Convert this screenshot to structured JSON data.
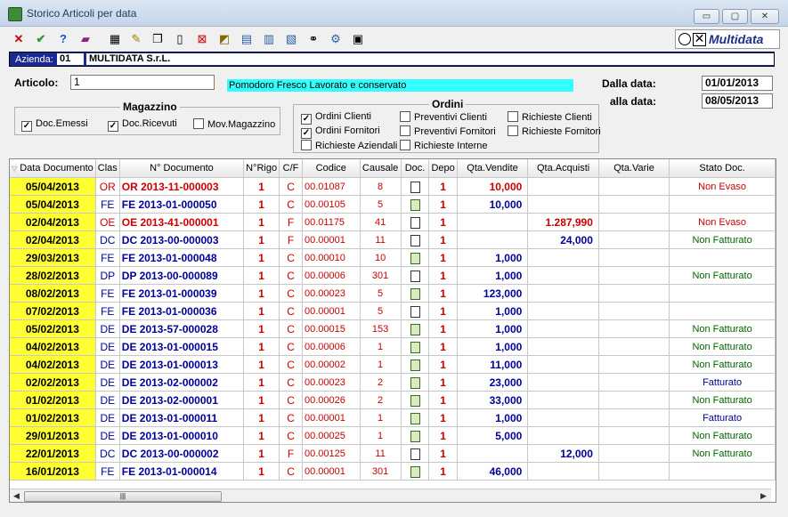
{
  "window": {
    "title": "Storico Articoli per data",
    "min": "▭",
    "max": "▢",
    "close": "✕"
  },
  "toolbar": {
    "icons": [
      "close-x-icon",
      "ok-check-icon",
      "help-icon",
      "book-icon",
      "print-icon",
      "edit-icon",
      "copy-icon",
      "new-doc-icon",
      "delete-icon",
      "chart-icon",
      "window-icon",
      "export-icon",
      "import-icon",
      "binoculars-icon",
      "settings-icon",
      "calc-icon"
    ]
  },
  "logo": {
    "text": "Multidata"
  },
  "azienda": {
    "label": "Azienda:",
    "code": "01",
    "name": "MULTIDATA S.r.L."
  },
  "articolo": {
    "label": "Articolo:",
    "value": "1",
    "description": "Pomodoro Fresco Lavorato e conservato"
  },
  "dates": {
    "from_label": "Dalla data:",
    "from": "01/01/2013",
    "to_label": "alla data:",
    "to": "08/05/2013"
  },
  "magazzino": {
    "title": "Magazzino",
    "options": [
      {
        "label": "Doc.Emessi",
        "checked": true
      },
      {
        "label": "Doc.Ricevuti",
        "checked": true
      },
      {
        "label": "Mov.Magazzino",
        "checked": false
      }
    ]
  },
  "ordini": {
    "title": "Ordini",
    "options": [
      {
        "label": "Ordini Clienti",
        "checked": true
      },
      {
        "label": "Preventivi Clienti",
        "checked": false
      },
      {
        "label": "Richieste Clienti",
        "checked": false
      },
      {
        "label": "Ordini Fornitori",
        "checked": true
      },
      {
        "label": "Preventivi Fornitori",
        "checked": false
      },
      {
        "label": "Richieste Fornitori",
        "checked": false
      },
      {
        "label": "Richieste Aziendali",
        "checked": false
      },
      {
        "label": "Richieste Interne",
        "checked": false
      }
    ]
  },
  "columns": [
    "Data Documento",
    "Clas",
    "N° Documento",
    "N°Rigo",
    "C/F",
    "Codice",
    "Causale",
    "Doc.",
    "Depo",
    "Qta.Vendite",
    "Qta.Acquisti",
    "Qta.Varie",
    "Stato Doc."
  ],
  "colors": {
    "red": "#cc0000",
    "blue": "#000099",
    "green": "#006600",
    "date_bg": "#ffff33"
  },
  "rows": [
    {
      "date": "05/04/2013",
      "clas": "OR",
      "num": "OR 2013-11-000003",
      "rigo": "1",
      "cf": "C",
      "codice": "00.01087",
      "causale": "8",
      "doc": "blank",
      "depo": "1",
      "vend": "10,000",
      "acq": "",
      "varie": "",
      "stato": "Non Evaso",
      "color": "red"
    },
    {
      "date": "05/04/2013",
      "clas": "FE",
      "num": "FE 2013-01-000050",
      "rigo": "1",
      "cf": "C",
      "codice": "00.00105",
      "causale": "5",
      "doc": "filled",
      "depo": "1",
      "vend": "10,000",
      "acq": "",
      "varie": "",
      "stato": "",
      "color": "blue"
    },
    {
      "date": "02/04/2013",
      "clas": "OE",
      "num": "OE 2013-41-000001",
      "rigo": "1",
      "cf": "F",
      "codice": "00.01175",
      "causale": "41",
      "doc": "blank",
      "depo": "1",
      "vend": "",
      "acq": "1.287,990",
      "varie": "",
      "stato": "Non Evaso",
      "color": "red"
    },
    {
      "date": "02/04/2013",
      "clas": "DC",
      "num": "DC 2013-00-000003",
      "rigo": "1",
      "cf": "F",
      "codice": "00.00001",
      "causale": "11",
      "doc": "blank",
      "depo": "1",
      "vend": "",
      "acq": "24,000",
      "varie": "",
      "stato": "Non Fatturato",
      "color": "blue"
    },
    {
      "date": "29/03/2013",
      "clas": "FE",
      "num": "FE 2013-01-000048",
      "rigo": "1",
      "cf": "C",
      "codice": "00.00010",
      "causale": "10",
      "doc": "filled",
      "depo": "1",
      "vend": "1,000",
      "acq": "",
      "varie": "",
      "stato": "",
      "color": "blue"
    },
    {
      "date": "28/02/2013",
      "clas": "DP",
      "num": "DP 2013-00-000089",
      "rigo": "1",
      "cf": "C",
      "codice": "00.00006",
      "causale": "301",
      "doc": "blank",
      "depo": "1",
      "vend": "1,000",
      "acq": "",
      "varie": "",
      "stato": "Non Fatturato",
      "color": "blue"
    },
    {
      "date": "08/02/2013",
      "clas": "FE",
      "num": "FE 2013-01-000039",
      "rigo": "1",
      "cf": "C",
      "codice": "00.00023",
      "causale": "5",
      "doc": "filled",
      "depo": "1",
      "vend": "123,000",
      "acq": "",
      "varie": "",
      "stato": "",
      "color": "blue"
    },
    {
      "date": "07/02/2013",
      "clas": "FE",
      "num": "FE 2013-01-000036",
      "rigo": "1",
      "cf": "C",
      "codice": "00.00001",
      "causale": "5",
      "doc": "blank",
      "depo": "1",
      "vend": "1,000",
      "acq": "",
      "varie": "",
      "stato": "",
      "color": "blue"
    },
    {
      "date": "05/02/2013",
      "clas": "DE",
      "num": "DE 2013-57-000028",
      "rigo": "1",
      "cf": "C",
      "codice": "00.00015",
      "causale": "153",
      "doc": "filled",
      "depo": "1",
      "vend": "1,000",
      "acq": "",
      "varie": "",
      "stato": "Non Fatturato",
      "color": "blue"
    },
    {
      "date": "04/02/2013",
      "clas": "DE",
      "num": "DE 2013-01-000015",
      "rigo": "1",
      "cf": "C",
      "codice": "00.00006",
      "causale": "1",
      "doc": "filled",
      "depo": "1",
      "vend": "1,000",
      "acq": "",
      "varie": "",
      "stato": "Non Fatturato",
      "color": "blue"
    },
    {
      "date": "04/02/2013",
      "clas": "DE",
      "num": "DE 2013-01-000013",
      "rigo": "1",
      "cf": "C",
      "codice": "00.00002",
      "causale": "1",
      "doc": "filled",
      "depo": "1",
      "vend": "11,000",
      "acq": "",
      "varie": "",
      "stato": "Non Fatturato",
      "color": "blue"
    },
    {
      "date": "02/02/2013",
      "clas": "DE",
      "num": "DE 2013-02-000002",
      "rigo": "1",
      "cf": "C",
      "codice": "00.00023",
      "causale": "2",
      "doc": "filled",
      "depo": "1",
      "vend": "23,000",
      "acq": "",
      "varie": "",
      "stato": "Fatturato",
      "color": "blue"
    },
    {
      "date": "01/02/2013",
      "clas": "DE",
      "num": "DE 2013-02-000001",
      "rigo": "1",
      "cf": "C",
      "codice": "00.00026",
      "causale": "2",
      "doc": "filled",
      "depo": "1",
      "vend": "33,000",
      "acq": "",
      "varie": "",
      "stato": "Non Fatturato",
      "color": "blue"
    },
    {
      "date": "01/02/2013",
      "clas": "DE",
      "num": "DE 2013-01-000011",
      "rigo": "1",
      "cf": "C",
      "codice": "00.00001",
      "causale": "1",
      "doc": "filled",
      "depo": "1",
      "vend": "1,000",
      "acq": "",
      "varie": "",
      "stato": "Fatturato",
      "color": "blue"
    },
    {
      "date": "29/01/2013",
      "clas": "DE",
      "num": "DE 2013-01-000010",
      "rigo": "1",
      "cf": "C",
      "codice": "00.00025",
      "causale": "1",
      "doc": "filled",
      "depo": "1",
      "vend": "5,000",
      "acq": "",
      "varie": "",
      "stato": "Non Fatturato",
      "color": "blue"
    },
    {
      "date": "22/01/2013",
      "clas": "DC",
      "num": "DC 2013-00-000002",
      "rigo": "1",
      "cf": "F",
      "codice": "00.00125",
      "causale": "11",
      "doc": "blank",
      "depo": "1",
      "vend": "",
      "acq": "12,000",
      "varie": "",
      "stato": "Non Fatturato",
      "color": "blue"
    },
    {
      "date": "16/01/2013",
      "clas": "FE",
      "num": "FE 2013-01-000014",
      "rigo": "1",
      "cf": "C",
      "codice": "00.00001",
      "causale": "301",
      "doc": "filled",
      "depo": "1",
      "vend": "46,000",
      "acq": "",
      "varie": "",
      "stato": "",
      "color": "blue"
    }
  ]
}
